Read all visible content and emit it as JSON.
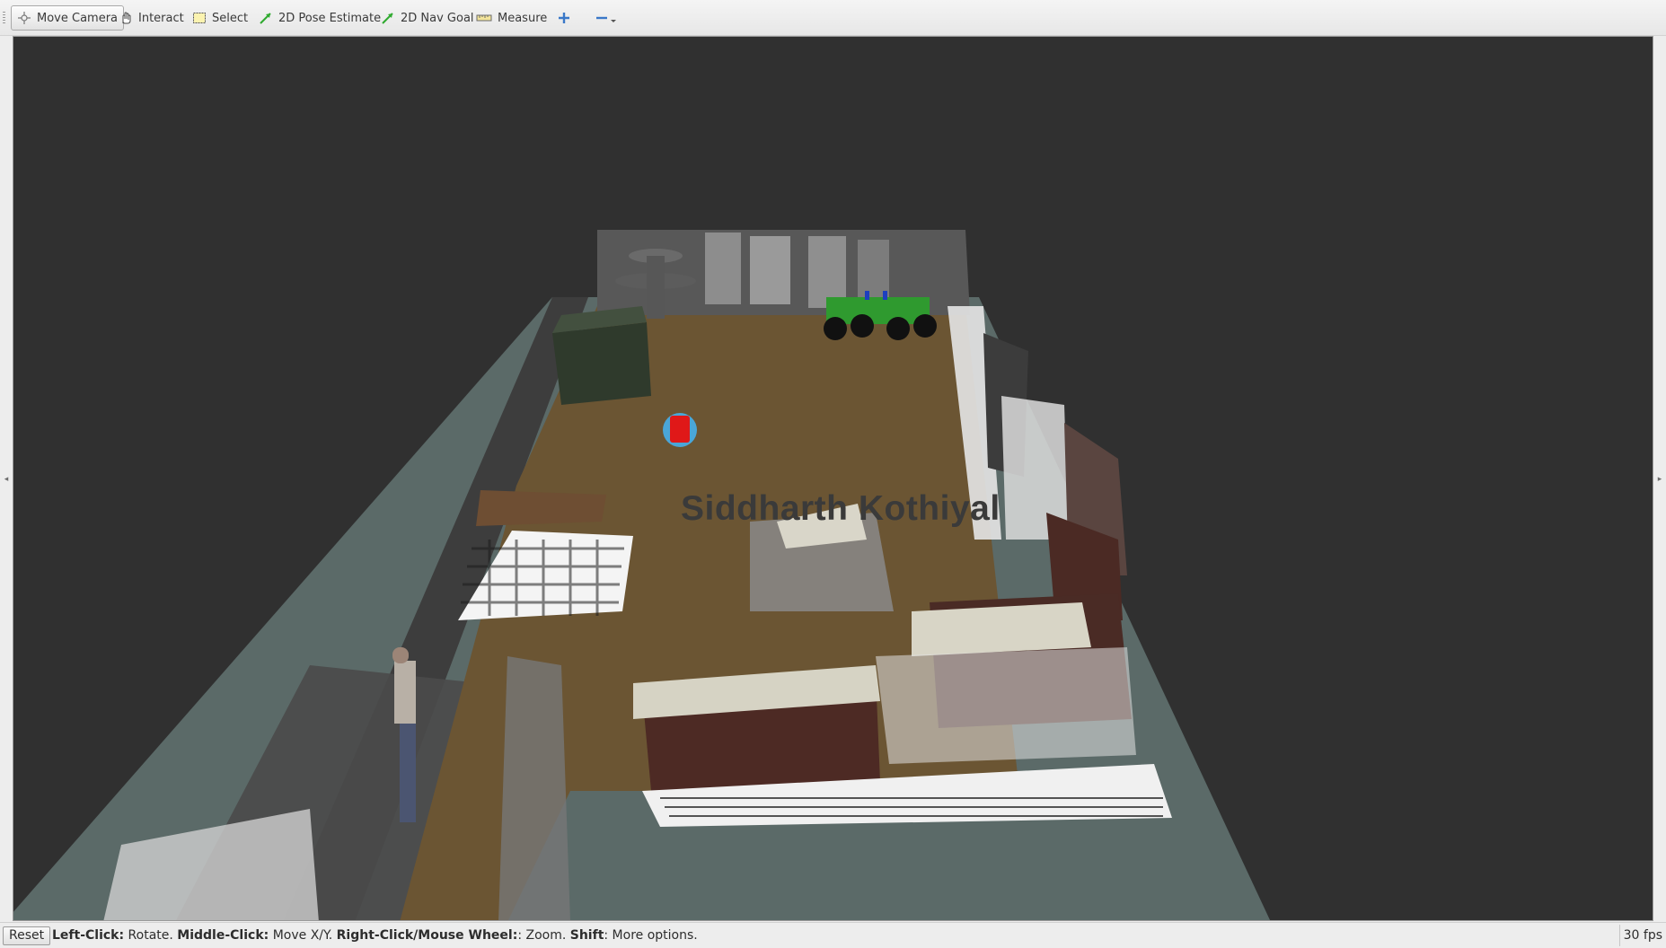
{
  "toolbar": {
    "tools": [
      {
        "label": "Move Camera",
        "icon": "move-camera-icon",
        "active": true
      },
      {
        "label": "Interact",
        "icon": "hand-icon"
      },
      {
        "label": "Select",
        "icon": "select-box-icon"
      },
      {
        "label": "2D Pose Estimate",
        "icon": "green-arrow-icon"
      },
      {
        "label": "2D Nav Goal",
        "icon": "green-arrow-icon"
      },
      {
        "label": "Measure",
        "icon": "ruler-icon"
      }
    ],
    "add_tool_icon": "plus-icon",
    "remove_tool_icon": "minus-icon"
  },
  "viewport": {
    "overlay_text": "Siddharth Kothiyal",
    "background_color": "#303030",
    "floor_color": "#5a6a68",
    "room_floor_color": "#6b5533"
  },
  "statusbar": {
    "reset_label": "Reset",
    "help": [
      {
        "key": "Left-Click:",
        "text": " Rotate. "
      },
      {
        "key": "Middle-Click:",
        "text": " Move X/Y. "
      },
      {
        "key": "Right-Click/Mouse Wheel:",
        "text": ": Zoom. "
      },
      {
        "key": "Shift",
        "text": ": More options."
      }
    ],
    "fps": "30 fps"
  }
}
